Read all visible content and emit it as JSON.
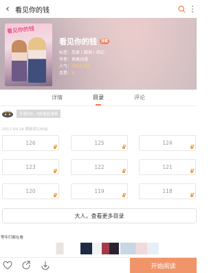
{
  "topbar": {
    "title": "看见你的钱"
  },
  "book": {
    "cover_title": "看见你的钱",
    "name": "看见你的钱",
    "tag": "连载",
    "genre_label": "标签：",
    "genre": "恋爱 | 脑洞 | 奇幻",
    "author_label": "作者：",
    "author": "来高动漫",
    "popularity_label": "人气：",
    "popularity": "3503.4万",
    "monthly_label": "月票：",
    "monthly": "8"
  },
  "tabs": [
    {
      "label": "详情"
    },
    {
      "label": "目录"
    },
    {
      "label": "评论"
    }
  ],
  "vip_text": "开通VIP，8折看此漫画",
  "update_text": "2017-09-26 更新到126话",
  "chapters": [
    "126",
    "125",
    "124",
    "123",
    "122",
    "121",
    "120",
    "119",
    "118"
  ],
  "more_chapters": "大人，查看更多目录",
  "also_reading": "等年们都在看",
  "read_button": "开始阅读",
  "colors": {
    "accent": "#f07d52",
    "read_button": "#f0956a",
    "lock": "#f1a14c"
  }
}
